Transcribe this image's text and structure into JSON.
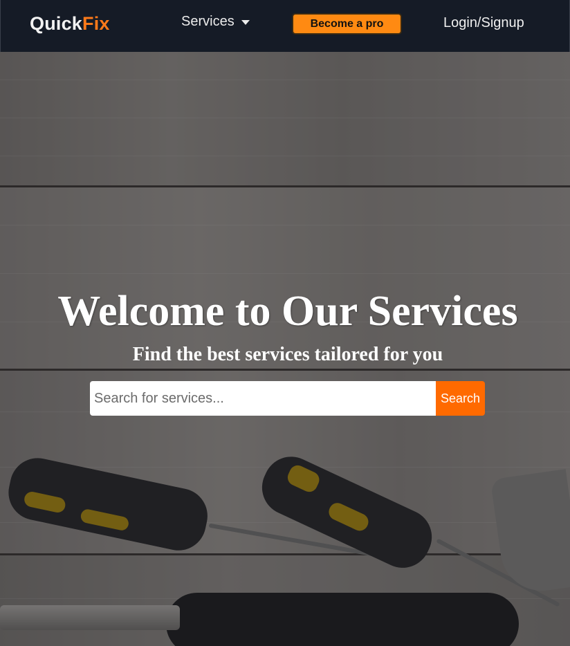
{
  "navbar": {
    "logo_part1": "Quick",
    "logo_part2": "Fix",
    "services_label": "Services",
    "become_pro_label": "Become a pro",
    "login_label": "Login/Signup"
  },
  "hero": {
    "title": "Welcome to Our Services",
    "subtitle": "Find the best services tailored for you",
    "search": {
      "placeholder": "Search for services...",
      "value": "",
      "button_label": "Search"
    }
  },
  "colors": {
    "nav_bg": "#151b26",
    "brand_orange": "#ff7a1a",
    "pro_button": "#ff8a12",
    "search_button": "#ff6a00"
  },
  "icons": {
    "services_dropdown": "caret-down-icon"
  }
}
